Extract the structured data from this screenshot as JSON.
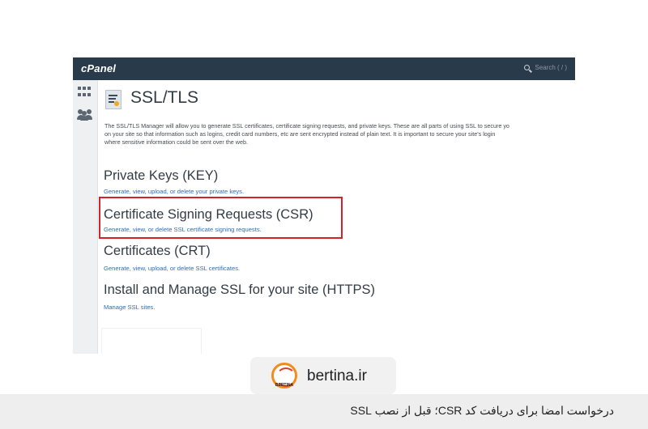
{
  "header": {
    "logo": "cPanel",
    "search_placeholder": "Search ( / )"
  },
  "sidebar": {
    "icons": [
      "grid-icon",
      "users-icon"
    ]
  },
  "page": {
    "title": "SSL/TLS",
    "intro": [
      "The SSL/TLS Manager will allow you to generate SSL certificates, certificate signing requests, and private keys. These are all parts of using SSL to secure yo",
      "on your site so that information such as logins, credit card numbers, etc are sent encrypted instead of plain text. It is important to secure your site's login",
      "where sensitive information could be sent over the web."
    ],
    "sections": [
      {
        "heading": "Private Keys (KEY)",
        "link": "Generate, view, upload, or delete your private keys."
      },
      {
        "heading": "Certificate Signing Requests (CSR)",
        "link": "Generate, view, or delete SSL certificate signing requests."
      },
      {
        "heading": "Certificates (CRT)",
        "link": "Generate, view, upload, or delete SSL certificates."
      },
      {
        "heading": "Install and Manage SSL for your site (HTTPS)",
        "link": "Manage SSL sites."
      }
    ]
  },
  "brand": {
    "name": "bertina.ir",
    "logo_word": "BERTINA"
  },
  "caption": "درخواست امضا برای دریافت کد CSR؛ قبل از نصب SSL",
  "colors": {
    "topbar": "#293a4a",
    "highlight": "#d3222a",
    "link": "#2f6db5"
  }
}
